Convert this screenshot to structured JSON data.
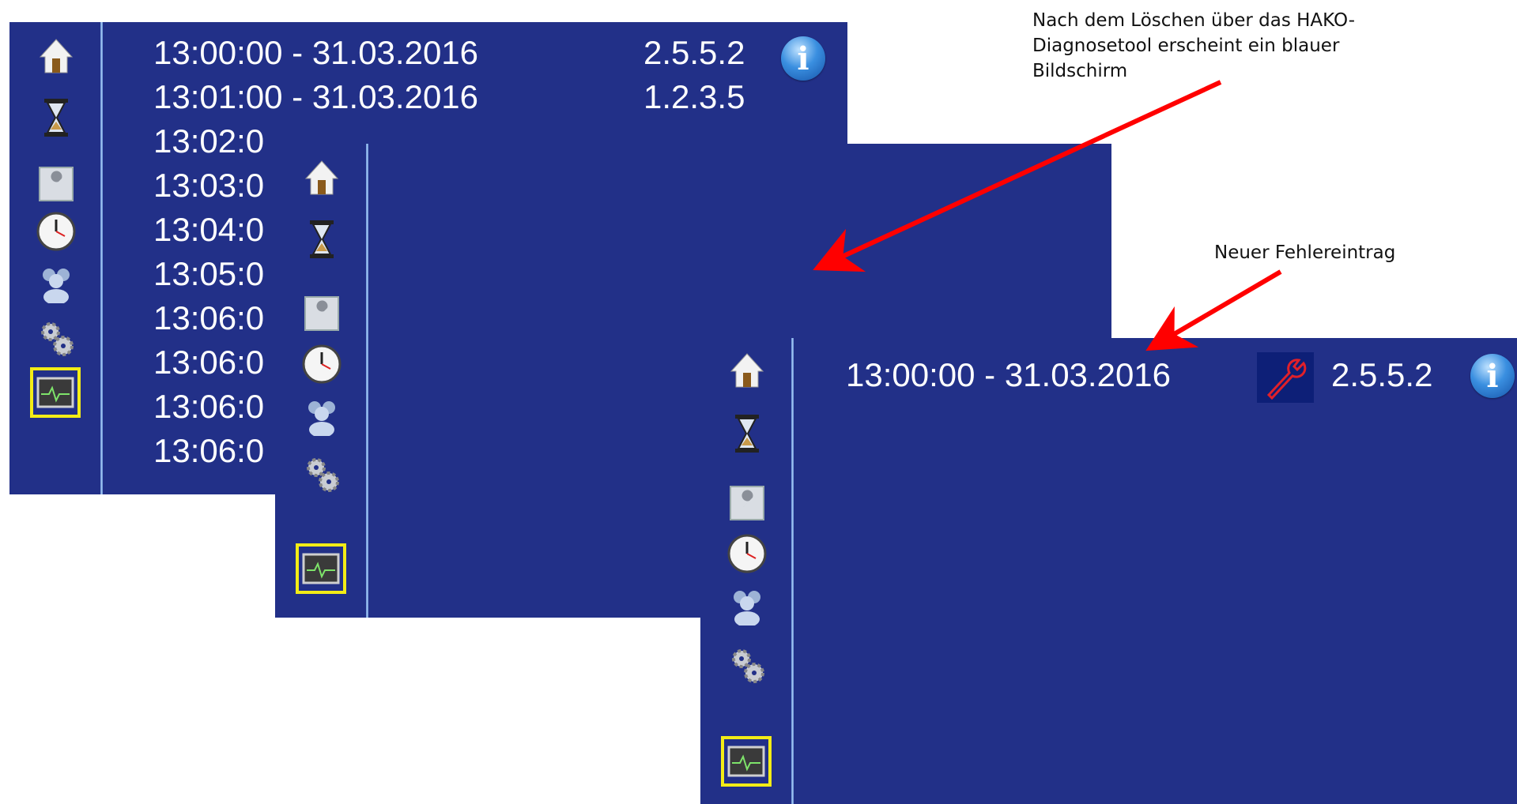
{
  "sidebar_icons": [
    "home-icon",
    "hourglass-icon",
    "wrench-tool-icon",
    "clock-icon",
    "users-icon",
    "gears-icon",
    "diagnostics-monitor-icon"
  ],
  "colors": {
    "screen_bg": "#223088",
    "selection": "#f3ec16",
    "annotation_arrow": "#ff0000",
    "wrench_error": "#e0202a"
  },
  "panel_a": {
    "rows": [
      {
        "time": "13:00:00  - 31.03.2016",
        "version": "2.5.5.2"
      },
      {
        "time": "13:01:00  - 31.03.2016",
        "version": "1.2.3.5"
      },
      {
        "time": "13:02:0"
      },
      {
        "time": "13:03:0"
      },
      {
        "time": "13:04:0"
      },
      {
        "time": "13:05:0"
      },
      {
        "time": "13:06:0"
      },
      {
        "time": "13:06:0"
      },
      {
        "time": "13:06:0"
      },
      {
        "time": "13:06:0"
      }
    ],
    "info_glyph": "i"
  },
  "panel_c": {
    "entry": {
      "time": "13:00:00  - 31.03.2016",
      "version": "2.5.5.2"
    },
    "info_glyph": "i"
  },
  "annotations": {
    "note_1": [
      "Nach dem Löschen über das HAKO-",
      "Diagnosetool erscheint ein blauer",
      "Bildschirm"
    ],
    "note_2": "Neuer Fehlereintrag"
  }
}
